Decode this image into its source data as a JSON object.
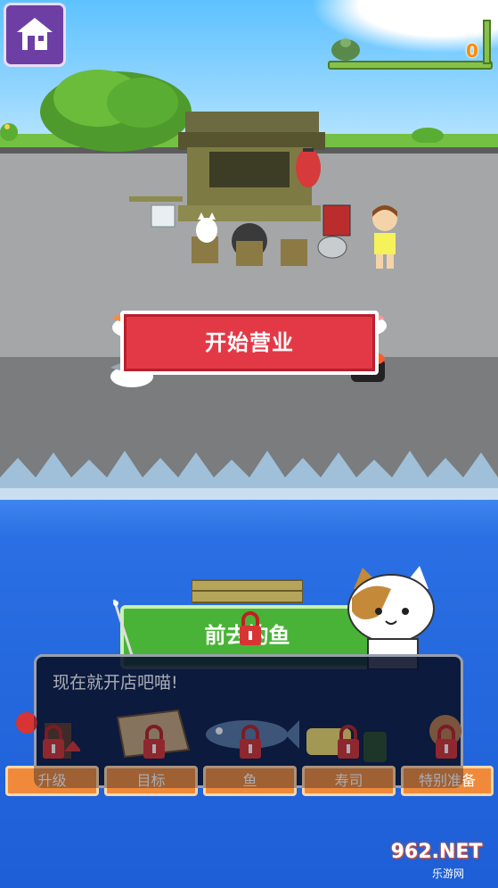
{
  "hud": {
    "coin_count": "0",
    "home_icon": "house-icon"
  },
  "main": {
    "start_button_label": "开始营业",
    "fishing_button_label": "前去钓鱼"
  },
  "dialog": {
    "text": "现在就开店吧喵!"
  },
  "menu": {
    "items": [
      {
        "label": "升级",
        "icon": "upgrade-icon"
      },
      {
        "label": "目标",
        "icon": "target-board-icon"
      },
      {
        "label": "鱼",
        "icon": "fish-icon"
      },
      {
        "label": "寿司",
        "icon": "sushi-icon"
      },
      {
        "label": "特别准备",
        "icon": "special-icon"
      }
    ]
  },
  "watermark": {
    "brand": "962.NET",
    "sub": "乐游网"
  },
  "colors": {
    "start_button": "#e33947",
    "fishing_button": "#49b337",
    "menu_button": "#f08a3a",
    "home_button": "#6d3fa5",
    "coin_text": "#ff8a00"
  }
}
